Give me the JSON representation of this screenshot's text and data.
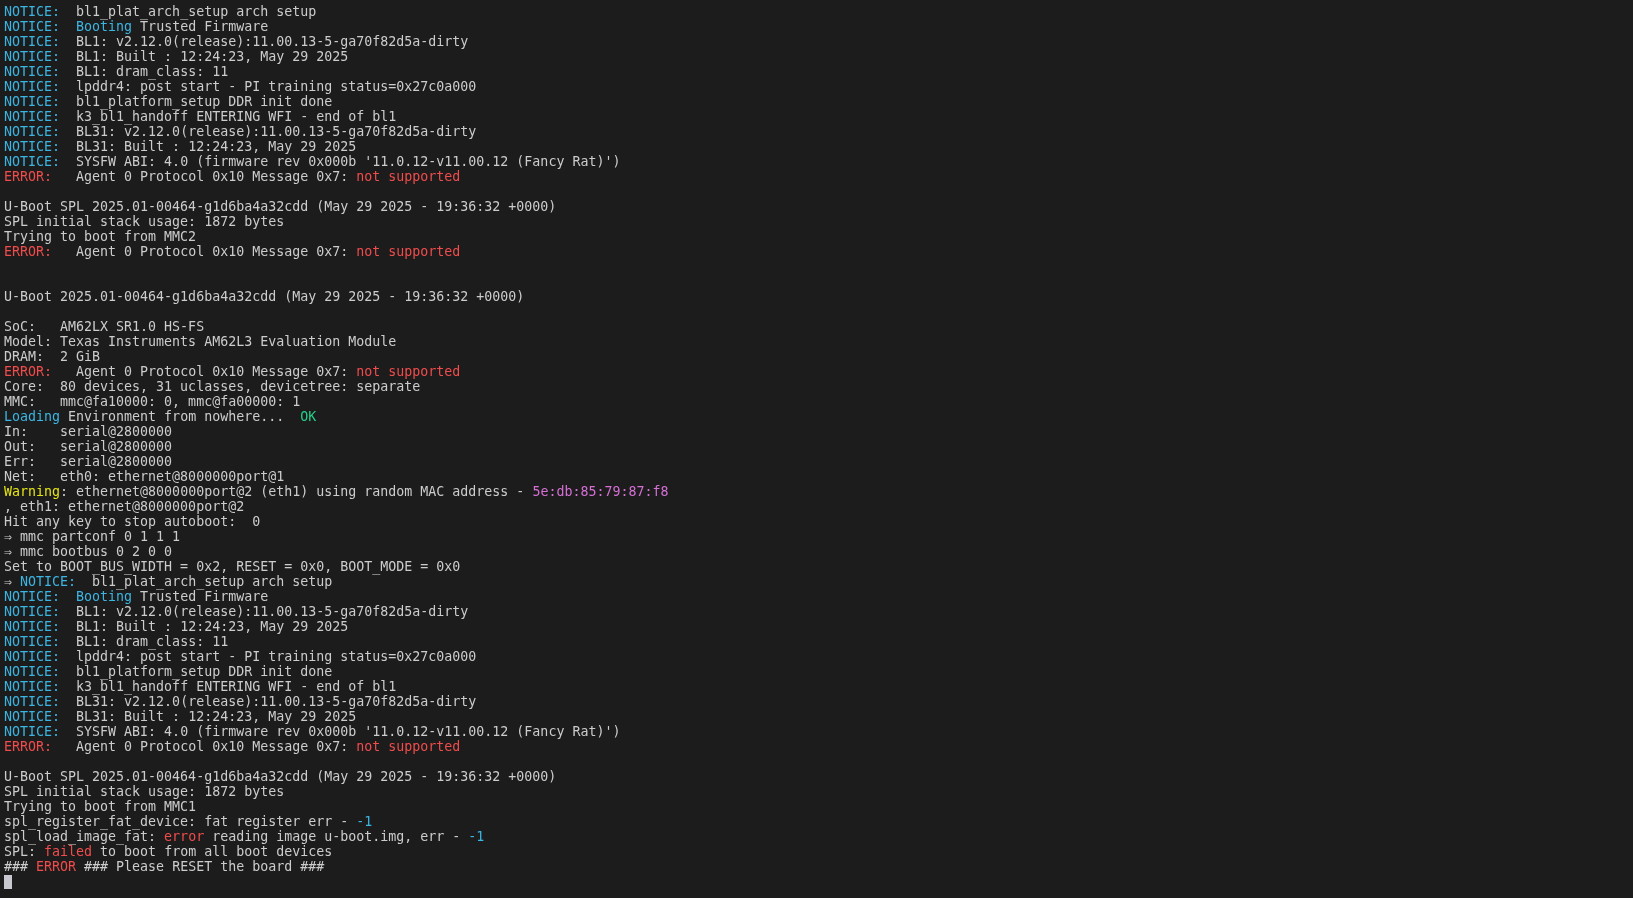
{
  "terminal": {
    "lines": [
      {
        "kind": "text",
        "segments": [
          {
            "text": "NOTICE:",
            "kind": "cyan"
          },
          {
            "text": "  bl1_plat_arch_setup arch setup",
            "kind": "plain"
          }
        ]
      },
      {
        "kind": "text",
        "segments": [
          {
            "text": "NOTICE:",
            "kind": "cyan"
          },
          {
            "text": "  Booting",
            "kind": "cyan"
          },
          {
            "text": " Trusted Firmware",
            "kind": "plain"
          }
        ]
      },
      {
        "kind": "text",
        "segments": [
          {
            "text": "NOTICE:",
            "kind": "cyan"
          },
          {
            "text": "  BL1: v2.12.0(release):11.00.13-5-ga70f82d5a-dirty",
            "kind": "plain"
          }
        ]
      },
      {
        "kind": "text",
        "segments": [
          {
            "text": "NOTICE:",
            "kind": "cyan"
          },
          {
            "text": "  BL1: Built : 12:24:23, May 29 2025",
            "kind": "plain"
          }
        ]
      },
      {
        "kind": "text",
        "segments": [
          {
            "text": "NOTICE:",
            "kind": "cyan"
          },
          {
            "text": "  BL1: dram_class: 11",
            "kind": "plain"
          }
        ]
      },
      {
        "kind": "text",
        "segments": [
          {
            "text": "NOTICE:",
            "kind": "cyan"
          },
          {
            "text": "  lpddr4: post start - PI training status=0x27c0a000",
            "kind": "plain"
          }
        ]
      },
      {
        "kind": "text",
        "segments": [
          {
            "text": "NOTICE:",
            "kind": "cyan"
          },
          {
            "text": "  bl1_platform_setup DDR init done",
            "kind": "plain"
          }
        ]
      },
      {
        "kind": "text",
        "segments": [
          {
            "text": "NOTICE:",
            "kind": "cyan"
          },
          {
            "text": "  k3_bl1_handoff ENTERING WFI - end of bl1",
            "kind": "plain"
          }
        ]
      },
      {
        "kind": "text",
        "segments": [
          {
            "text": "NOTICE:",
            "kind": "cyan"
          },
          {
            "text": "  BL31: v2.12.0(release):11.00.13-5-ga70f82d5a-dirty",
            "kind": "plain"
          }
        ]
      },
      {
        "kind": "text",
        "segments": [
          {
            "text": "NOTICE:",
            "kind": "cyan"
          },
          {
            "text": "  BL31: Built : 12:24:23, May 29 2025",
            "kind": "plain"
          }
        ]
      },
      {
        "kind": "text",
        "segments": [
          {
            "text": "NOTICE:",
            "kind": "cyan"
          },
          {
            "text": "  SYSFW ABI: 4.0 (firmware rev 0x000b '11.0.12-v11.00.12 (Fancy Rat)')",
            "kind": "plain"
          }
        ]
      },
      {
        "kind": "text",
        "segments": [
          {
            "text": "ERROR:",
            "kind": "red"
          },
          {
            "text": "   Agent 0 Protocol 0x10 Message 0x7: ",
            "kind": "plain"
          },
          {
            "text": "not supported",
            "kind": "red"
          }
        ]
      },
      {
        "kind": "blank"
      },
      {
        "kind": "text",
        "segments": [
          {
            "text": "U-Boot SPL 2025.01-00464-g1d6ba4a32cdd (May 29 2025 - 19:36:32 +0000)",
            "kind": "plain"
          }
        ]
      },
      {
        "kind": "text",
        "segments": [
          {
            "text": "SPL initial stack usage: 1872 bytes",
            "kind": "plain"
          }
        ]
      },
      {
        "kind": "text",
        "segments": [
          {
            "text": "Trying to boot from MMC2",
            "kind": "plain"
          }
        ]
      },
      {
        "kind": "text",
        "segments": [
          {
            "text": "ERROR:",
            "kind": "red"
          },
          {
            "text": "   Agent 0 Protocol 0x10 Message 0x7: ",
            "kind": "plain"
          },
          {
            "text": "not supported",
            "kind": "red"
          }
        ]
      },
      {
        "kind": "blank"
      },
      {
        "kind": "blank"
      },
      {
        "kind": "text",
        "segments": [
          {
            "text": "U-Boot 2025.01-00464-g1d6ba4a32cdd (May 29 2025 - 19:36:32 +0000)",
            "kind": "plain"
          }
        ]
      },
      {
        "kind": "blank"
      },
      {
        "kind": "text",
        "segments": [
          {
            "text": "SoC:   AM62LX SR1.0 HS-FS",
            "kind": "plain"
          }
        ]
      },
      {
        "kind": "text",
        "segments": [
          {
            "text": "Model: Texas Instruments AM62L3 Evaluation Module",
            "kind": "plain"
          }
        ]
      },
      {
        "kind": "text",
        "segments": [
          {
            "text": "DRAM:  2 GiB",
            "kind": "plain"
          }
        ]
      },
      {
        "kind": "text",
        "segments": [
          {
            "text": "ERROR:",
            "kind": "red"
          },
          {
            "text": "   Agent 0 Protocol 0x10 Message 0x7: ",
            "kind": "plain"
          },
          {
            "text": "not supported",
            "kind": "red"
          }
        ]
      },
      {
        "kind": "text",
        "segments": [
          {
            "text": "Core:  80 devices, 31 uclasses, devicetree: separate",
            "kind": "plain"
          }
        ]
      },
      {
        "kind": "text",
        "segments": [
          {
            "text": "MMC:   mmc@fa10000: 0, mmc@fa00000: 1",
            "kind": "plain"
          }
        ]
      },
      {
        "kind": "text",
        "segments": [
          {
            "text": "Loading",
            "kind": "cyan"
          },
          {
            "text": " Environment from nowhere...  ",
            "kind": "plain"
          },
          {
            "text": "OK",
            "kind": "green"
          }
        ]
      },
      {
        "kind": "text",
        "segments": [
          {
            "text": "In:    serial@2800000",
            "kind": "plain"
          }
        ]
      },
      {
        "kind": "text",
        "segments": [
          {
            "text": "Out:   serial@2800000",
            "kind": "plain"
          }
        ]
      },
      {
        "kind": "text",
        "segments": [
          {
            "text": "Err:   serial@2800000",
            "kind": "plain"
          }
        ]
      },
      {
        "kind": "text",
        "segments": [
          {
            "text": "Net:   eth0: ethernet@8000000port@1",
            "kind": "plain"
          }
        ]
      },
      {
        "kind": "text",
        "segments": [
          {
            "text": "Warning",
            "kind": "yellow"
          },
          {
            "text": ": ethernet@8000000port@2 (eth1) using random MAC address - ",
            "kind": "plain"
          },
          {
            "text": "5e:db:85:79:87:f8",
            "kind": "magenta"
          }
        ]
      },
      {
        "kind": "text",
        "segments": [
          {
            "text": ", eth1: ethernet@8000000port@2",
            "kind": "plain"
          }
        ]
      },
      {
        "kind": "text",
        "segments": [
          {
            "text": "Hit any key to stop autoboot:  0",
            "kind": "plain"
          }
        ]
      },
      {
        "kind": "text",
        "segments": [
          {
            "text": "⇒ mmc partconf 0 1 1 1",
            "kind": "plain"
          }
        ]
      },
      {
        "kind": "text",
        "segments": [
          {
            "text": "⇒ mmc bootbus 0 2 0 0",
            "kind": "plain"
          }
        ]
      },
      {
        "kind": "text",
        "segments": [
          {
            "text": "Set to BOOT_BUS_WIDTH = 0x2, RESET = 0x0, BOOT_MODE = 0x0",
            "kind": "plain"
          }
        ]
      },
      {
        "kind": "text",
        "segments": [
          {
            "text": "⇒ ",
            "kind": "plain"
          },
          {
            "text": "NOTICE:",
            "kind": "cyan"
          },
          {
            "text": "  bl1_plat_arch_setup arch setup",
            "kind": "plain"
          }
        ]
      },
      {
        "kind": "text",
        "segments": [
          {
            "text": "NOTICE:",
            "kind": "cyan"
          },
          {
            "text": "  Booting",
            "kind": "cyan"
          },
          {
            "text": " Trusted Firmware",
            "kind": "plain"
          }
        ]
      },
      {
        "kind": "text",
        "segments": [
          {
            "text": "NOTICE:",
            "kind": "cyan"
          },
          {
            "text": "  BL1: v2.12.0(release):11.00.13-5-ga70f82d5a-dirty",
            "kind": "plain"
          }
        ]
      },
      {
        "kind": "text",
        "segments": [
          {
            "text": "NOTICE:",
            "kind": "cyan"
          },
          {
            "text": "  BL1: Built : 12:24:23, May 29 2025",
            "kind": "plain"
          }
        ]
      },
      {
        "kind": "text",
        "segments": [
          {
            "text": "NOTICE:",
            "kind": "cyan"
          },
          {
            "text": "  BL1: dram_class: 11",
            "kind": "plain"
          }
        ]
      },
      {
        "kind": "text",
        "segments": [
          {
            "text": "NOTICE:",
            "kind": "cyan"
          },
          {
            "text": "  lpddr4: post start - PI training status=0x27c0a000",
            "kind": "plain"
          }
        ]
      },
      {
        "kind": "text",
        "segments": [
          {
            "text": "NOTICE:",
            "kind": "cyan"
          },
          {
            "text": "  bl1_platform_setup DDR init done",
            "kind": "plain"
          }
        ]
      },
      {
        "kind": "text",
        "segments": [
          {
            "text": "NOTICE:",
            "kind": "cyan"
          },
          {
            "text": "  k3_bl1_handoff ENTERING WFI - end of bl1",
            "kind": "plain"
          }
        ]
      },
      {
        "kind": "text",
        "segments": [
          {
            "text": "NOTICE:",
            "kind": "cyan"
          },
          {
            "text": "  BL31: v2.12.0(release):11.00.13-5-ga70f82d5a-dirty",
            "kind": "plain"
          }
        ]
      },
      {
        "kind": "text",
        "segments": [
          {
            "text": "NOTICE:",
            "kind": "cyan"
          },
          {
            "text": "  BL31: Built : 12:24:23, May 29 2025",
            "kind": "plain"
          }
        ]
      },
      {
        "kind": "text",
        "segments": [
          {
            "text": "NOTICE:",
            "kind": "cyan"
          },
          {
            "text": "  SYSFW ABI: 4.0 (firmware rev 0x000b '11.0.12-v11.00.12 (Fancy Rat)')",
            "kind": "plain"
          }
        ]
      },
      {
        "kind": "text",
        "segments": [
          {
            "text": "ERROR:",
            "kind": "red"
          },
          {
            "text": "   Agent 0 Protocol 0x10 Message 0x7: ",
            "kind": "plain"
          },
          {
            "text": "not supported",
            "kind": "red"
          }
        ]
      },
      {
        "kind": "blank"
      },
      {
        "kind": "text",
        "segments": [
          {
            "text": "U-Boot SPL 2025.01-00464-g1d6ba4a32cdd (May 29 2025 - 19:36:32 +0000)",
            "kind": "plain"
          }
        ]
      },
      {
        "kind": "text",
        "segments": [
          {
            "text": "SPL initial stack usage: 1872 bytes",
            "kind": "plain"
          }
        ]
      },
      {
        "kind": "text",
        "segments": [
          {
            "text": "Trying to boot from MMC1",
            "kind": "plain"
          }
        ]
      },
      {
        "kind": "text",
        "segments": [
          {
            "text": "spl_register_fat_device: fat register err - ",
            "kind": "plain"
          },
          {
            "text": "-1",
            "kind": "cyan"
          }
        ]
      },
      {
        "kind": "text",
        "segments": [
          {
            "text": "spl_load_image_fat: ",
            "kind": "plain"
          },
          {
            "text": "error",
            "kind": "red"
          },
          {
            "text": " reading image u-boot.img, err - ",
            "kind": "plain"
          },
          {
            "text": "-1",
            "kind": "cyan"
          }
        ]
      },
      {
        "kind": "text",
        "segments": [
          {
            "text": "SPL: ",
            "kind": "plain"
          },
          {
            "text": "failed",
            "kind": "red"
          },
          {
            "text": " to boot from all boot devices",
            "kind": "plain"
          }
        ]
      },
      {
        "kind": "text",
        "segments": [
          {
            "text": "### ",
            "kind": "plain"
          },
          {
            "text": "ERROR",
            "kind": "red"
          },
          {
            "text": " ### Please RESET the board ###",
            "kind": "plain"
          }
        ]
      },
      {
        "kind": "cursor"
      }
    ]
  }
}
